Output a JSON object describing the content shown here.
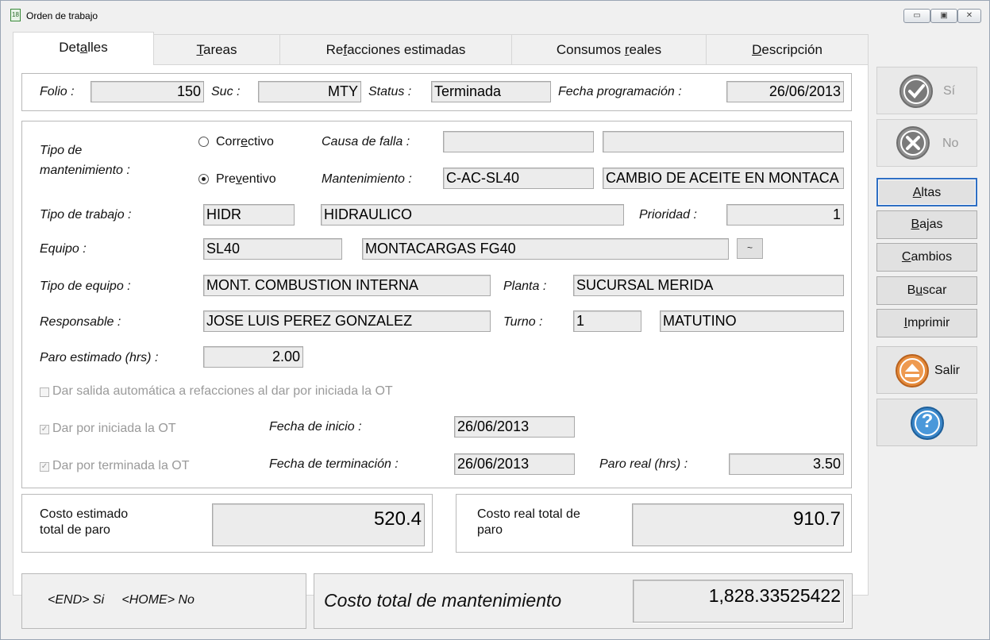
{
  "window": {
    "title": "Orden de trabajo",
    "app_icon_text": "18"
  },
  "tabs": [
    {
      "pre": "Det",
      "u": "a",
      "post": "lles",
      "active": true
    },
    {
      "pre": "",
      "u": "T",
      "post": "areas",
      "active": false
    },
    {
      "pre": "Re",
      "u": "f",
      "post": "acciones estimadas",
      "active": false
    },
    {
      "pre": "Consumos ",
      "u": "r",
      "post": "eales",
      "active": false
    },
    {
      "pre": "",
      "u": "D",
      "post": "escripción",
      "active": false
    }
  ],
  "header": {
    "folio_label": "Folio :",
    "folio": "150",
    "suc_label": "Suc :",
    "suc": "MTY",
    "status_label": "Status :",
    "status": "Terminada",
    "fecha_prog_label": "Fecha programación :",
    "fecha_prog": "26/06/2013"
  },
  "details": {
    "tipo_mant_label_1": "Tipo de",
    "tipo_mant_label_2": "mantenimiento :",
    "correctivo": {
      "pre": "Corr",
      "u": "e",
      "post": "ctivo",
      "selected": false
    },
    "preventivo": {
      "pre": "Pre",
      "u": "v",
      "post": "entivo",
      "selected": true
    },
    "causa_label": "Causa de falla :",
    "causa_code": "",
    "causa_desc": "",
    "mant_label": "Mantenimiento :",
    "mant_code": "C-AC-SL40",
    "mant_desc": "CAMBIO DE ACEITE EN MONTACA",
    "tipo_trabajo_label": "Tipo de trabajo :",
    "tipo_trabajo_code": "HIDR",
    "tipo_trabajo_desc": "HIDRAULICO",
    "prioridad_label": "Prioridad :",
    "prioridad": "1",
    "equipo_label": "Equipo :",
    "equipo_code": "SL40",
    "equipo_desc": "MONTACARGAS FG40",
    "equipo_lookup": "~",
    "tipo_equipo_label": "Tipo de equipo :",
    "tipo_equipo": "MONT. COMBUSTION INTERNA",
    "planta_label": "Planta :",
    "planta": "SUCURSAL MERIDA",
    "responsable_label": "Responsable :",
    "responsable": "JOSE LUIS PEREZ GONZALEZ",
    "turno_label": "Turno :",
    "turno_code": "1",
    "turno_desc": "MATUTINO",
    "paro_est_label": "Paro estimado (hrs) :",
    "paro_est": "2.00",
    "chk_salida_label": "Dar salida automática a refacciones al dar por iniciada la OT",
    "chk_salida": false,
    "chk_iniciada_label": "Dar por iniciada la OT",
    "chk_iniciada": true,
    "fecha_inicio_label": "Fecha de inicio :",
    "fecha_inicio": "26/06/2013",
    "chk_terminada_label": "Dar por terminada la OT",
    "chk_terminada": true,
    "fecha_term_label": "Fecha de terminación :",
    "fecha_term": "26/06/2013",
    "paro_real_label": "Paro real (hrs) :",
    "paro_real": "3.50"
  },
  "costs": {
    "est_label_1": "Costo estimado",
    "est_label_2": "total de paro",
    "est_value": "520.4",
    "real_label_1": "Costo real total de",
    "real_label_2": "paro",
    "real_value": "910.7"
  },
  "footer": {
    "keys_hint": "<END> Si     <HOME> No",
    "total_label": "Costo total de mantenimiento",
    "total_value": "1,828.33525422"
  },
  "side": {
    "si_label": "Sí",
    "no_label": "No",
    "altas": {
      "pre": "",
      "u": "A",
      "post": "ltas"
    },
    "bajas": {
      "pre": "",
      "u": "B",
      "post": "ajas"
    },
    "cambios": {
      "pre": "",
      "u": "C",
      "post": "ambios"
    },
    "buscar": {
      "pre": "B",
      "u": "u",
      "post": "scar"
    },
    "imprimir": {
      "pre": "",
      "u": "I",
      "post": "mprimir"
    },
    "salir_label": "Salir",
    "help_glyph": "?"
  },
  "colors": {
    "focus": "#2f6fc4",
    "help": "#3a86c8",
    "salir": "#e58a3a"
  }
}
